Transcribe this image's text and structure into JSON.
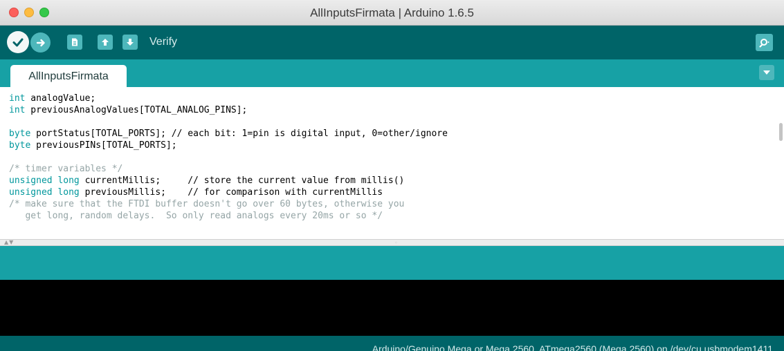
{
  "window": {
    "title": "AllInputsFirmata | Arduino 1.6.5"
  },
  "toolbar": {
    "buttons": [
      {
        "name": "verify",
        "icon": "check-icon"
      },
      {
        "name": "upload",
        "icon": "arrow-right-icon"
      },
      {
        "name": "new",
        "icon": "new-file-icon"
      },
      {
        "name": "open",
        "icon": "arrow-up-icon"
      },
      {
        "name": "save",
        "icon": "arrow-down-icon"
      }
    ],
    "hover_label": "Verify",
    "serial_monitor_icon": "magnifier-icon"
  },
  "tabs": [
    {
      "label": "AllInputsFirmata",
      "active": true
    }
  ],
  "editor": {
    "lines": [
      [
        {
          "t": "int",
          "c": "kw"
        },
        {
          "t": " analogValue;",
          "c": ""
        }
      ],
      [
        {
          "t": "int",
          "c": "kw"
        },
        {
          "t": " previousAnalogValues[TOTAL_ANALOG_PINS];",
          "c": ""
        }
      ],
      [],
      [
        {
          "t": "byte",
          "c": "kw"
        },
        {
          "t": " portStatus[TOTAL_PORTS]; // each bit: 1=pin is digital input, 0=other/ignore",
          "c": ""
        }
      ],
      [
        {
          "t": "byte",
          "c": "kw"
        },
        {
          "t": " previousPINs[TOTAL_PORTS];",
          "c": ""
        }
      ],
      [],
      [
        {
          "t": "/* timer variables */",
          "c": "cm"
        }
      ],
      [
        {
          "t": "unsigned long",
          "c": "kw"
        },
        {
          "t": " currentMillis;     // store the current value from millis()",
          "c": ""
        }
      ],
      [
        {
          "t": "unsigned long",
          "c": "kw"
        },
        {
          "t": " previousMillis;    // for comparison with currentMillis",
          "c": ""
        }
      ],
      [
        {
          "t": "/* make sure that the FTDI buffer doesn't go over 60 bytes, otherwise you",
          "c": "cm"
        }
      ],
      [
        {
          "t": "   get long, random delays.  So only read analogs every 20ms or so */",
          "c": "cm"
        }
      ]
    ]
  },
  "divider": {
    "arrows": "▲▼",
    "grip": "◦"
  },
  "status_bar": {
    "board": "Arduino/Genuino Mega or Mega 2560, ATmega2560 (Mega 2560) on /dev/cu.usbmodem1411"
  },
  "colors": {
    "toolbar": "#006468",
    "tabbar": "#17a1a5",
    "keyword": "#00979c",
    "comment": "#95a5a6",
    "console": "#000000"
  }
}
